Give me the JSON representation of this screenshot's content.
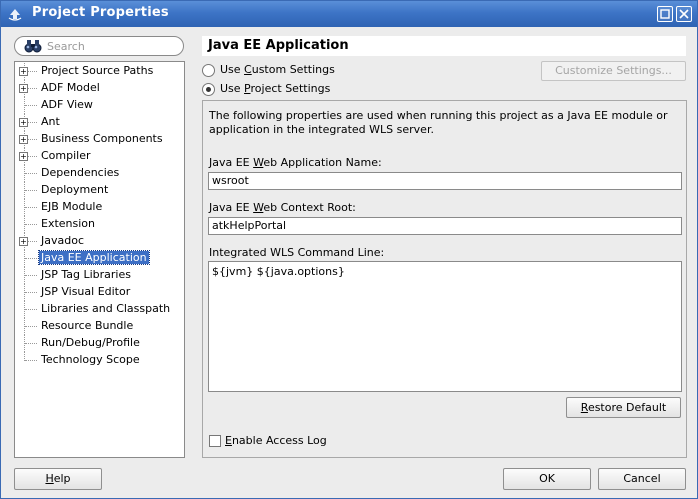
{
  "window": {
    "title": "Project Properties"
  },
  "search": {
    "placeholder": "Search"
  },
  "tree": {
    "items": [
      {
        "label": "Project Source Paths",
        "expandable": true
      },
      {
        "label": "ADF Model",
        "expandable": true
      },
      {
        "label": "ADF View",
        "expandable": false
      },
      {
        "label": "Ant",
        "expandable": true
      },
      {
        "label": "Business Components",
        "expandable": true
      },
      {
        "label": "Compiler",
        "expandable": true
      },
      {
        "label": "Dependencies",
        "expandable": false
      },
      {
        "label": "Deployment",
        "expandable": false
      },
      {
        "label": "EJB Module",
        "expandable": false
      },
      {
        "label": "Extension",
        "expandable": false
      },
      {
        "label": "Javadoc",
        "expandable": true
      },
      {
        "label": "Java EE Application",
        "expandable": false,
        "selected": true
      },
      {
        "label": "JSP Tag Libraries",
        "expandable": false
      },
      {
        "label": "JSP Visual Editor",
        "expandable": false
      },
      {
        "label": "Libraries and Classpath",
        "expandable": false
      },
      {
        "label": "Resource Bundle",
        "expandable": false
      },
      {
        "label": "Run/Debug/Profile",
        "expandable": false
      },
      {
        "label": "Technology Scope",
        "expandable": false
      }
    ]
  },
  "panel": {
    "title": "Java EE Application",
    "radio_custom": {
      "pre": "Use ",
      "mnemonic": "C",
      "post": "ustom Settings",
      "checked": false
    },
    "radio_project": {
      "pre": "Use ",
      "mnemonic": "P",
      "post": "roject Settings",
      "checked": true
    },
    "customize_button": "Customize Settings...",
    "description": "The following properties are used when running this project as a Java EE module or application in the integrated WLS server.",
    "web_app_name": {
      "label_pre": "Java EE ",
      "label_mnemonic": "W",
      "label_post": "eb Application Name:",
      "value": "wsroot"
    },
    "context_root": {
      "label_pre": "Java EE ",
      "label_mnemonic": "W",
      "label_post": "eb Context Root:",
      "value": "atkHelpPortal"
    },
    "command_line": {
      "label": "Integrated WLS Command Line:",
      "value": "${jvm} ${java.options}"
    },
    "restore_default": {
      "mnemonic": "R",
      "rest": "estore Default"
    },
    "enable_access_log": {
      "mnemonic": "E",
      "rest": "nable Access Log",
      "checked": false
    }
  },
  "footer": {
    "help": {
      "mnemonic": "H",
      "rest": "elp"
    },
    "ok": "OK",
    "cancel": "Cancel"
  },
  "colors": {
    "titlebar": "#3d74c6",
    "selection": "#3d6fc5"
  }
}
